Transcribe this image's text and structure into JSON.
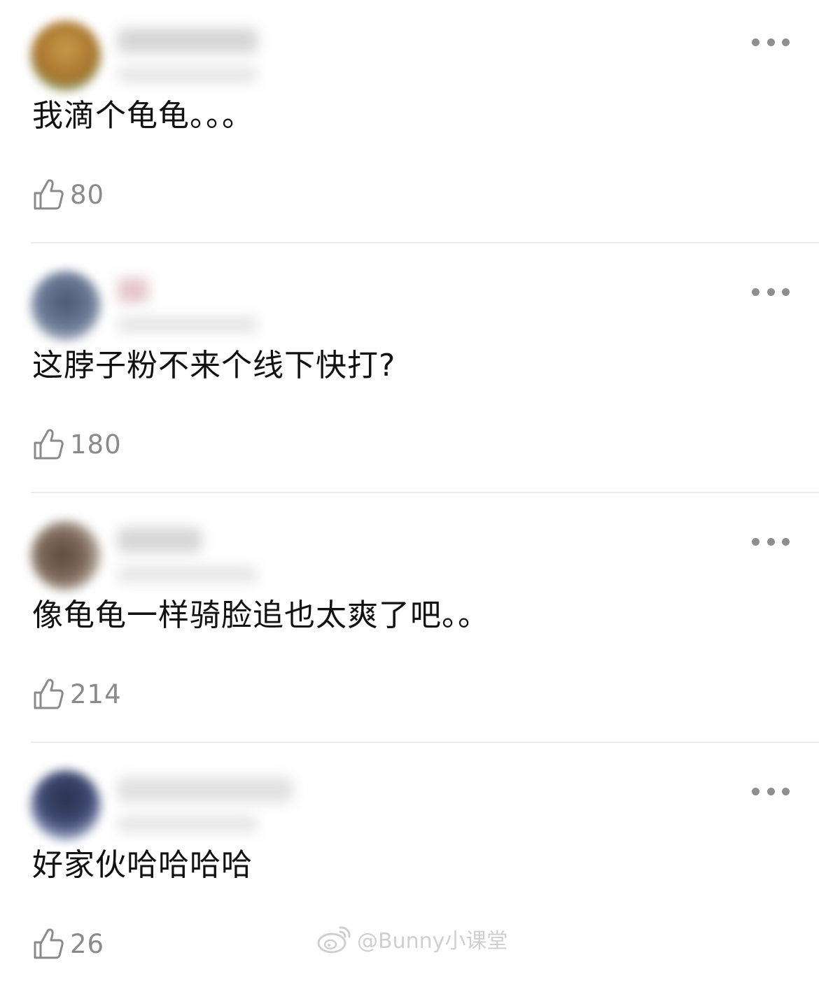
{
  "comments": [
    {
      "text": "我滴个龟龟。。。",
      "likes": "80",
      "avatar_color": "#b98a3c",
      "avatar_color2": "#7fae7c"
    },
    {
      "text": "这脖子粉不来个线下快打?",
      "likes": "180",
      "avatar_color": "#5a6b86",
      "avatar_color2": "#b6bdc9"
    },
    {
      "text": "像龟龟一样骑脸追也太爽了吧。。",
      "likes": "214",
      "avatar_color": "#6b5a4c",
      "avatar_color2": "#d5cfc7"
    },
    {
      "text": "好家伙哈哈哈哈",
      "likes": "26",
      "avatar_color": "#323a55",
      "avatar_color2": "#aab4d6"
    }
  ],
  "watermark": {
    "text": "@Bunny小课堂",
    "icon": "weibo-icon"
  },
  "icons": {
    "like": "thumb-up-icon",
    "more": "more-dots-icon"
  },
  "colors": {
    "text": "#111111",
    "secondary": "#8a8a8a",
    "divider": "#ececec",
    "dots": "#8e8e8e"
  }
}
